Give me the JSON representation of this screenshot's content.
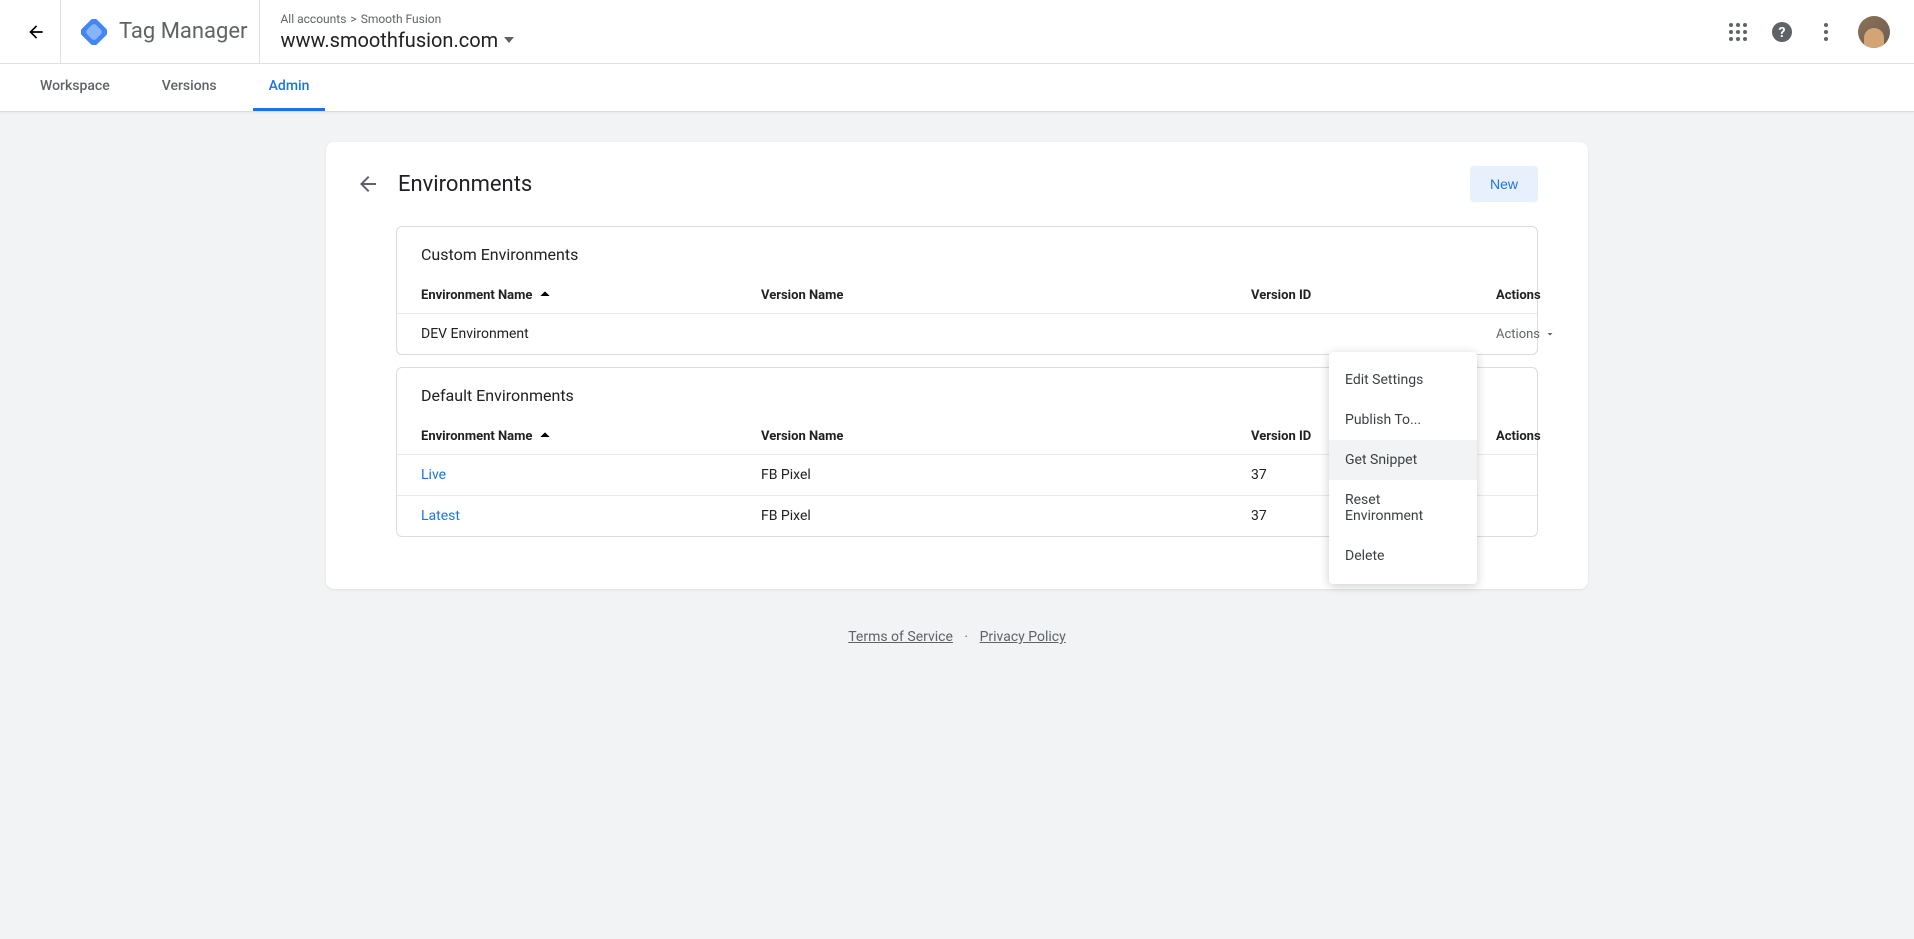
{
  "header": {
    "productName": "Tag Manager",
    "breadcrumbRoot": "All accounts",
    "breadcrumbAccount": "Smooth Fusion",
    "containerName": "www.smoothfusion.com"
  },
  "tabs": {
    "workspace": "Workspace",
    "versions": "Versions",
    "admin": "Admin"
  },
  "page": {
    "title": "Environments",
    "newButton": "New"
  },
  "customSection": {
    "title": "Custom Environments",
    "columns": {
      "env": "Environment Name",
      "ver": "Version Name",
      "vid": "Version ID",
      "act": "Actions"
    },
    "rows": [
      {
        "env": "DEV Environment",
        "ver": "",
        "vid": "",
        "actionsLabel": "Actions"
      }
    ]
  },
  "defaultSection": {
    "title": "Default Environments",
    "columns": {
      "env": "Environment Name",
      "ver": "Version Name",
      "vid": "Version ID",
      "act": "Actions"
    },
    "rows": [
      {
        "env": "Live",
        "ver": "FB Pixel",
        "vid": "37"
      },
      {
        "env": "Latest",
        "ver": "FB Pixel",
        "vid": "37"
      }
    ]
  },
  "dropdown": {
    "editSettings": "Edit Settings",
    "publishTo": "Publish To...",
    "getSnippet": "Get Snippet",
    "resetEnv": "Reset Environment",
    "delete": "Delete"
  },
  "footer": {
    "tos": "Terms of Service",
    "privacy": "Privacy Policy"
  }
}
